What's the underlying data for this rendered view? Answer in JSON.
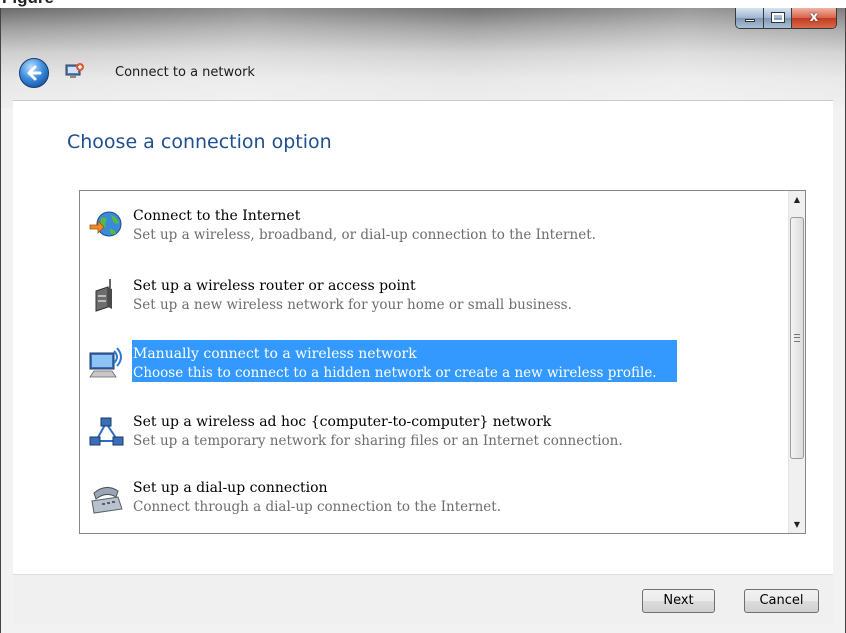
{
  "window": {
    "title": "Connect to a network",
    "caption_buttons": {
      "minimize": "minimize",
      "maximize": "maximize",
      "close": "x"
    }
  },
  "page": {
    "heading": "Choose a connection option"
  },
  "options": [
    {
      "title": "Connect to the Internet",
      "description": "Set up a wireless, broadband, or dial-up connection to the Internet.",
      "icon": "globe-icon",
      "selected": false
    },
    {
      "title": "Set up a wireless router or access point",
      "description": "Set up a new wireless network for your home or small business.",
      "icon": "router-icon",
      "selected": false
    },
    {
      "title": "Manually connect to a wireless network",
      "description": "Choose this to connect to a hidden network or create a new wireless profile.",
      "icon": "wireless-computer-icon",
      "selected": true
    },
    {
      "title": "Set up a wireless ad hoc {computer-to-computer} network",
      "description": "Set up a temporary network for sharing files or an Internet connection.",
      "icon": "ad-hoc-network-icon",
      "selected": false
    },
    {
      "title": "Set up a dial-up connection",
      "description": "Connect through a dial-up connection to the Internet.",
      "icon": "dialup-phone-icon",
      "selected": false
    }
  ],
  "buttons": {
    "next": "Next",
    "cancel": "Cancel"
  },
  "colors": {
    "heading": "#1f4f8f",
    "selection": "#3399ff",
    "description": "#6d6d6d"
  }
}
